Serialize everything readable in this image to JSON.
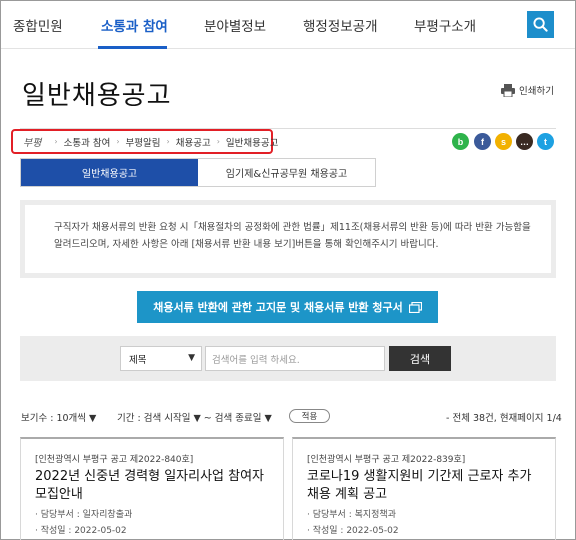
{
  "gnb": {
    "menus": [
      "종합민원",
      "소통과 참여",
      "분야별정보",
      "행정정보공개",
      "부평구소개"
    ]
  },
  "page": {
    "title": "일반채용공고",
    "print_label": "인쇄하기"
  },
  "breadcrumb": {
    "logo": "부평",
    "items": [
      "소통과 참여",
      "부평알림",
      "채용공고",
      "일반채용공고"
    ]
  },
  "sns": [
    {
      "name": "blog",
      "glyph": "b",
      "color": "#2eb34b"
    },
    {
      "name": "facebook",
      "glyph": "f",
      "color": "#3b5a9a"
    },
    {
      "name": "kakaostory",
      "glyph": "s",
      "color": "#f2b100"
    },
    {
      "name": "talk",
      "glyph": "…",
      "color": "#3a2a22"
    },
    {
      "name": "twitter",
      "glyph": "t",
      "color": "#1da1e2"
    }
  ],
  "tabs": [
    "일반채용공고",
    "임기제&신규공무원 채용공고"
  ],
  "notice": {
    "line1": "구직자가 채용서류의 반환 요청 시「채용절차의 공정화에 관한 법률」제11조(채용서류의 반환 등)에 따라 반환 가능함을",
    "line2": "알려드리오며, 자세한 사항은 아래 [채용서류 반환 내용 보기]버튼을 통해 확인해주시기 바랍니다."
  },
  "return_button": "채용서류 반환에 관한 고지문 및 채용서류 반환 청구서",
  "search": {
    "select_value": "제목",
    "placeholder": "검색어를 입력 하세요.",
    "submit": "검색"
  },
  "filters": {
    "view_count": "보기수 :  10개씩 ▼",
    "period": "기간 :  검색 시작일 ▼  ~  검색 종료일 ▼",
    "apply": "적용",
    "total": "- 전체 38건, 현재페이지 1/4"
  },
  "cards": [
    {
      "tag": "[인천광역시 부평구 공고 제2022-840호]",
      "title": "2022년 신중년 경력형 일자리사업 참여자 모집안내",
      "dept": "· 담당부서 : 일자리창출과",
      "date": "· 작성일 : 2022-05-02"
    },
    {
      "tag": "[인천광역시 부평구 공고 제2022-839호]",
      "title": "코로나19 생활지원비 기간제 근로자 추가 채용 계획 공고",
      "dept": "· 담당부서 : 복지정책과",
      "date": "· 작성일 : 2022-05-02"
    }
  ]
}
